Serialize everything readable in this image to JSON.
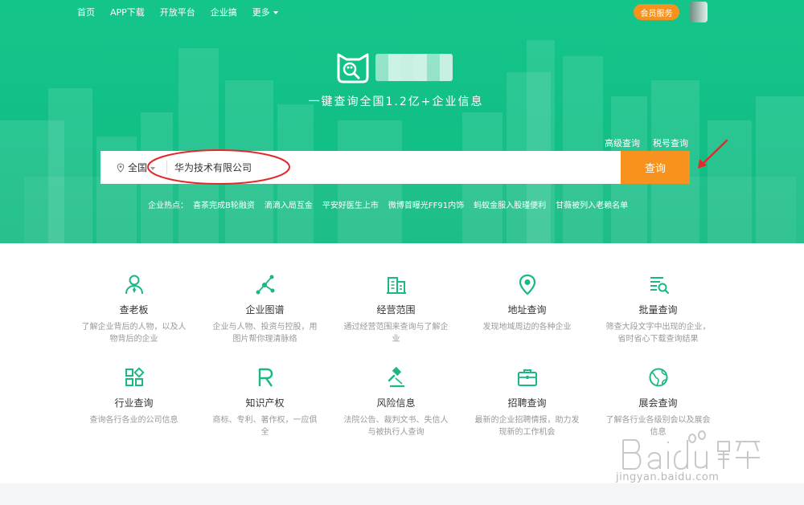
{
  "nav": {
    "items": [
      "首页",
      "APP下载",
      "开放平台",
      "企业搞"
    ],
    "more_label": "更多",
    "vip_button": "会员服务"
  },
  "hero": {
    "slogan": "一键查询全国1.2亿+企业信息",
    "advanced_search": "高级查询",
    "tax_search": "税号查询"
  },
  "search": {
    "region": "全国",
    "query": "华为技术有限公司",
    "button": "查询"
  },
  "hot": {
    "label": "企业热点：",
    "items": [
      "喜茶完成B轮融资",
      "滴滴入局互金",
      "平安好医生上市",
      "微博首曝光FF91内饰",
      "蚂蚁金服入股瑾便利",
      "甘薇被列入老赖名单"
    ]
  },
  "features": [
    {
      "icon": "person-icon",
      "title": "查老板",
      "desc": "了解企业背后的人物，以及人物背后的企业"
    },
    {
      "icon": "graph-icon",
      "title": "企业图谱",
      "desc": "企业与人物、投资与控股，用图片帮你理清脉络"
    },
    {
      "icon": "building-icon",
      "title": "经营范围",
      "desc": "通过经营范围来查询与了解企业"
    },
    {
      "icon": "location-pin-icon",
      "title": "地址查询",
      "desc": "发现地域周边的各种企业"
    },
    {
      "icon": "batch-search-icon",
      "title": "批量查询",
      "desc": "筛查大段文字中出现的企业，省时省心下载查询结果"
    },
    {
      "icon": "grid-apps-icon",
      "title": "行业查询",
      "desc": "查询各行各业的公司信息"
    },
    {
      "icon": "registered-r-icon",
      "title": "知识产权",
      "desc": "商标、专利、著作权，一应俱全"
    },
    {
      "icon": "gavel-icon",
      "title": "风险信息",
      "desc": "法院公告、裁判文书、失信人与被执行人查询"
    },
    {
      "icon": "briefcase-icon",
      "title": "招聘查询",
      "desc": "最新的企业招聘情报，助力发现新的工作机会"
    },
    {
      "icon": "globe-icon",
      "title": "展会查询",
      "desc": "了解各行业各级别会以及展会信息"
    }
  ],
  "watermark": {
    "url": "jingyan.baidu.com"
  },
  "colors": {
    "brand_green": "#12bf86",
    "accent_orange": "#f7921e",
    "annotation_red": "#e02b2b"
  }
}
